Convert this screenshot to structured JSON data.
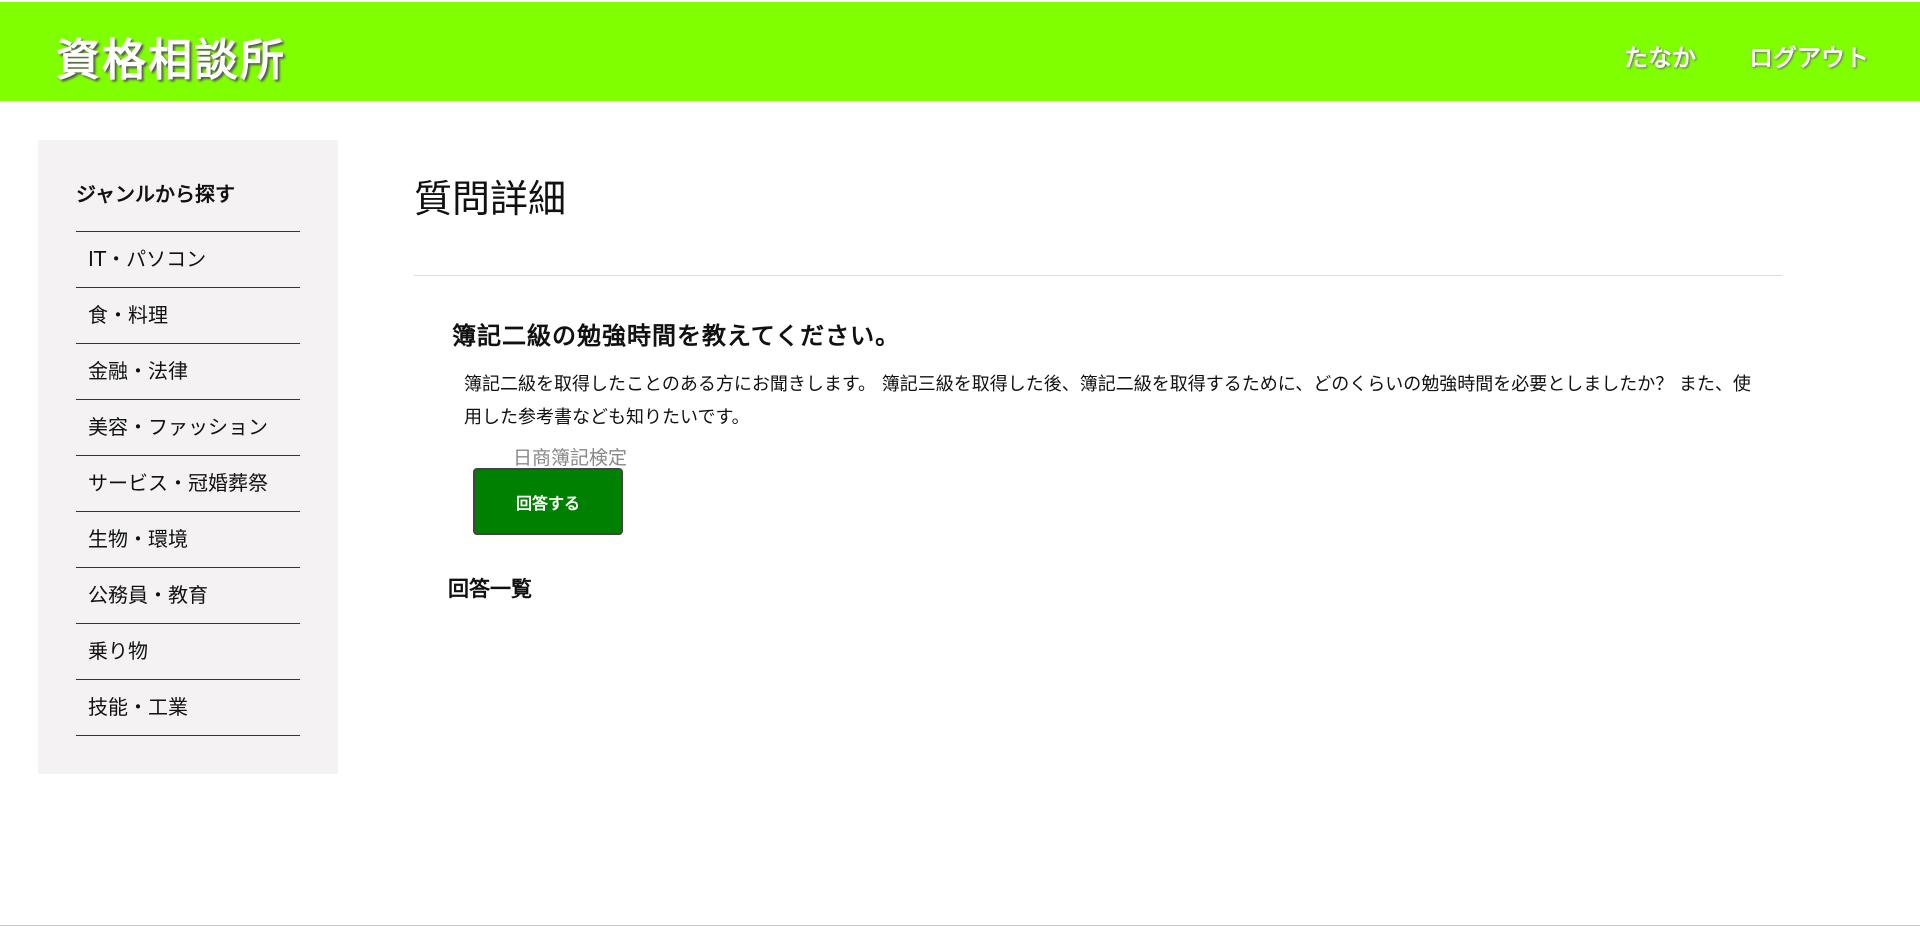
{
  "header": {
    "logo": "資格相談所",
    "user_name": "たなか",
    "logout_label": "ログアウト",
    "background_color": "#80ff00"
  },
  "sidebar": {
    "title": "ジャンルから探す",
    "items": [
      {
        "label": "IT・パソコン"
      },
      {
        "label": "食・料理"
      },
      {
        "label": "金融・法律"
      },
      {
        "label": "美容・ファッション"
      },
      {
        "label": "サービス・冠婚葬祭"
      },
      {
        "label": "生物・環境"
      },
      {
        "label": "公務員・教育"
      },
      {
        "label": "乗り物"
      },
      {
        "label": "技能・工業"
      }
    ]
  },
  "main": {
    "page_title": "質問詳細",
    "question": {
      "title": "簿記二級の勉強時間を教えてください。",
      "body": "簿記二級を取得したことのある方にお聞きします。 簿記三級を取得した後、簿記二級を取得するために、どのくらいの勉強時間を必要としましたか？ また、使用した参考書なども知りたいです。",
      "tag": "日商簿記検定"
    },
    "answer_button_label": "回答する",
    "answer_button_color": "#008000",
    "answers_heading": "回答一覧"
  }
}
